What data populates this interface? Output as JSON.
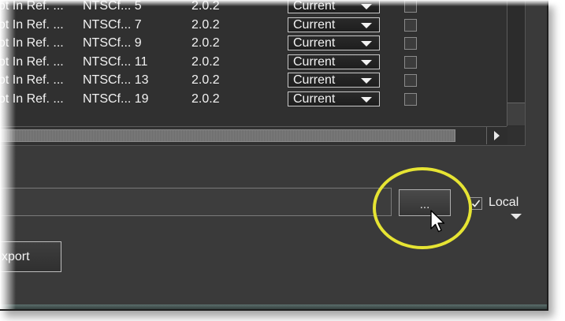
{
  "table": {
    "rows": [
      {
        "name": "ot In Ref. ...",
        "format": "NTSCf... 5",
        "version": "2.0.2",
        "select": "Current",
        "checked": false
      },
      {
        "name": "ot In Ref. ...",
        "format": "NTSCf... 7",
        "version": "2.0.2",
        "select": "Current",
        "checked": false
      },
      {
        "name": "ot In Ref. ...",
        "format": "NTSCf... 9",
        "version": "2.0.2",
        "select": "Current",
        "checked": false
      },
      {
        "name": "ot In Ref. ...",
        "format": "NTSCf... 11",
        "version": "2.0.2",
        "select": "Current",
        "checked": false
      },
      {
        "name": "ot In Ref. ...",
        "format": "NTSCf... 13",
        "version": "2.0.2",
        "select": "Current",
        "checked": false
      },
      {
        "name": "ot In Ref. ...",
        "format": "NTSCf... 19",
        "version": "2.0.2",
        "select": "Current",
        "checked": false
      }
    ]
  },
  "path": {
    "value": ""
  },
  "browse_label": "...",
  "local": {
    "label": "Local",
    "checked": true
  },
  "export_label": "xport",
  "icons": {
    "dropdown": "chevron-down-icon",
    "cursor": "mouse-pointer-icon",
    "checkmark": "checkmark-icon"
  },
  "colors": {
    "panel": "#3a3a3a",
    "highlight": "#e6e433",
    "text": "#f2f2f2"
  }
}
